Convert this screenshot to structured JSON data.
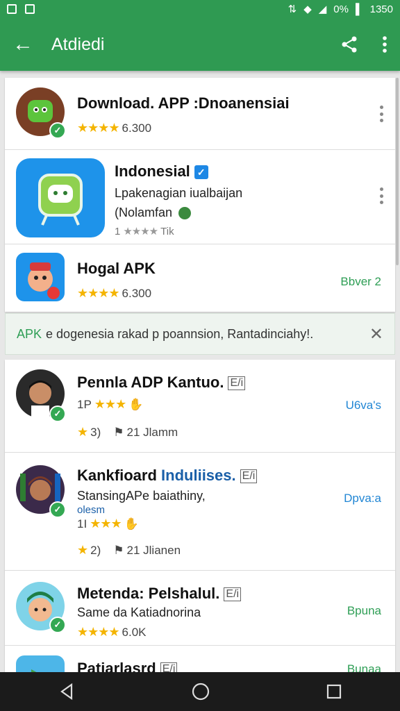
{
  "status": {
    "signal_text": "0%",
    "time": "1350"
  },
  "appbar": {
    "title": "Atdiedi"
  },
  "top_apps": [
    {
      "name": "Download. APP :Dnoanensiai",
      "rating_text": "6.300"
    },
    {
      "name": "Indonesial",
      "line1": "Lpakenagian iualbaijan",
      "line2": "(Nolamfan",
      "rating_text": "Tik"
    },
    {
      "name": "Hogal APK",
      "rating_text": "6.300",
      "action": "Bbver 2"
    }
  ],
  "banner": {
    "lead": "APK",
    "text": "e dogenesia rakad p poannsion, Rantadinciahy!."
  },
  "list_apps": [
    {
      "name": "Pennla ADP Kantuo.",
      "tag": "E/i",
      "stars_prefix": "1P",
      "meta_left": "3)",
      "meta_right": "21 Jlamm",
      "action": "U6va's"
    },
    {
      "name_a": "Kankfioard",
      "name_b": "Induliises.",
      "tag": "E/i",
      "desc": "StansingAPe baiathiny,",
      "desc2": "olesm",
      "stars_prefix": "1I",
      "meta_left": "2)",
      "meta_right": "21 Jlianen",
      "action": "Dpva:a"
    },
    {
      "name": "Metenda: Pelshalul.",
      "tag": "E/i",
      "desc": "Same da Katiadnorina",
      "rating_text": "6.0K",
      "action": "Bpuna"
    },
    {
      "name": "Patiarlasrd",
      "tag": "E/i",
      "action": "Bunaa"
    }
  ],
  "colors": {
    "brand_green": "#2f9a52",
    "accent_blue": "#2186d4",
    "star": "#f4b400"
  }
}
